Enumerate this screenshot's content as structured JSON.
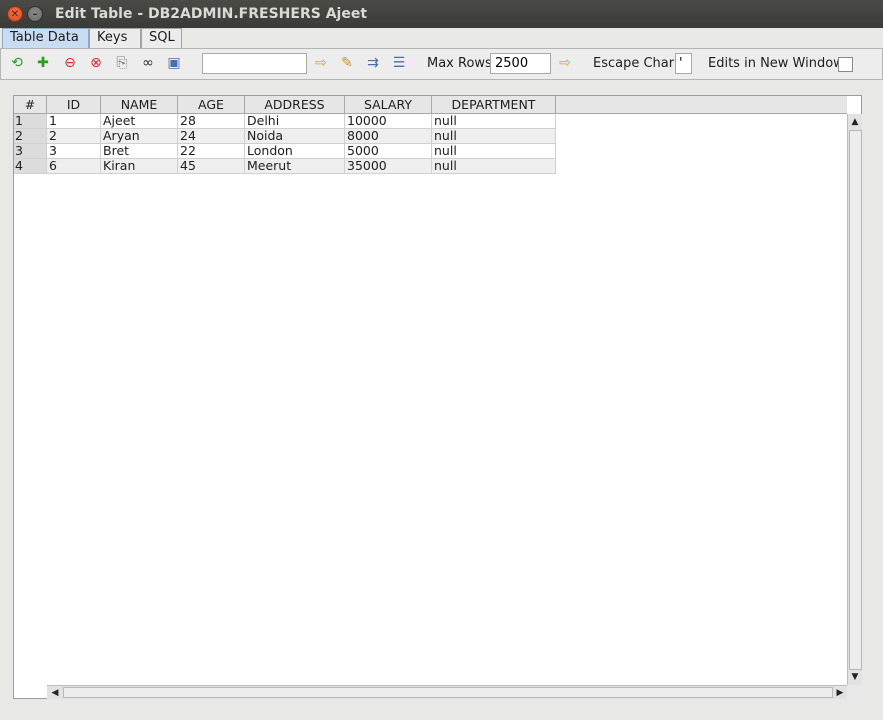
{
  "window": {
    "title": "Edit Table - DB2ADMIN.FRESHERS Ajeet",
    "close_glyph": "✕",
    "min_glyph": "–"
  },
  "tabs": [
    {
      "label": "Table Data"
    },
    {
      "label": "Keys"
    },
    {
      "label": "SQL"
    }
  ],
  "toolbar": {
    "icons": [
      {
        "name": "refresh-icon",
        "glyph": "⟲",
        "color": "#2e9a2e"
      },
      {
        "name": "add-row-icon",
        "glyph": "✚",
        "color": "#2f9d1c"
      },
      {
        "name": "delete-row-icon",
        "glyph": "⊖",
        "color": "#d62a2a"
      },
      {
        "name": "cancel-icon",
        "glyph": "⊗",
        "color": "#d62a2a"
      },
      {
        "name": "copy-icon",
        "glyph": "⎘",
        "color": "#7a7a7a"
      },
      {
        "name": "paste-icon",
        "glyph": "▤",
        "color": "#7a7a7a"
      },
      {
        "name": "find-icon",
        "glyph": "∞",
        "color": "#333333"
      },
      {
        "name": "save-icon",
        "glyph": "▣",
        "color": "#4a6ea8"
      }
    ],
    "filter_value": "",
    "go_glyph": "⇨",
    "action_icons": [
      {
        "name": "edit-sql-icon",
        "glyph": "✎",
        "color": "#c8922a"
      },
      {
        "name": "run-icon",
        "glyph": "⇉",
        "color": "#4a6ea8"
      },
      {
        "name": "format-icon",
        "glyph": "☰",
        "color": "#4a6ea8"
      }
    ],
    "max_rows_label": "Max Rows",
    "max_rows_value": "2500",
    "escape_char_label": "Escape Char",
    "escape_char_value": "'",
    "edits_new_window_label": "Edits in New Window",
    "edits_new_window_checked": false,
    "accent_arrow_color": "#e0a316"
  },
  "table": {
    "columns": [
      "#",
      "ID",
      "NAME",
      "AGE",
      "ADDRESS",
      "SALARY",
      "DEPARTMENT"
    ],
    "rows": [
      [
        "1",
        "1",
        "Ajeet",
        "28",
        "Delhi",
        "10000",
        "null"
      ],
      [
        "2",
        "2",
        "Aryan",
        "24",
        "Noida",
        "8000",
        "null"
      ],
      [
        "3",
        "3",
        "Bret",
        "22",
        "London",
        "5000",
        "null"
      ],
      [
        "4",
        "6",
        "Kiran",
        "45",
        "Meerut",
        "35000",
        "null"
      ]
    ]
  },
  "scroll": {
    "up": "▲",
    "down": "▼",
    "left": "◀",
    "right": "▶"
  }
}
